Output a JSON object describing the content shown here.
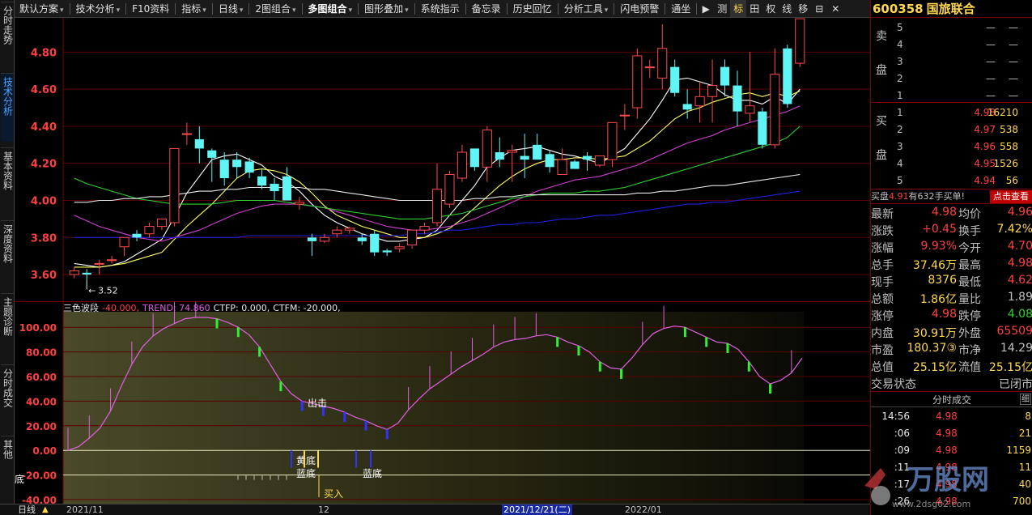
{
  "toolbar": {
    "items": [
      {
        "label": "默认方案",
        "dropdown": true
      },
      {
        "label": "技术分析",
        "dropdown": true
      },
      {
        "label": "F10资料",
        "dropdown": false
      },
      {
        "label": "指标",
        "dropdown": true
      },
      {
        "label": "日线",
        "dropdown": true
      },
      {
        "label": "2图组合",
        "dropdown": true
      },
      {
        "label": "多图组合",
        "dropdown": true,
        "active": true
      },
      {
        "label": "图形叠加",
        "dropdown": true
      },
      {
        "label": "系统指示",
        "dropdown": false
      },
      {
        "label": "备忘录",
        "dropdown": false
      },
      {
        "label": "历史回忆",
        "dropdown": false
      },
      {
        "label": "分析工具",
        "dropdown": true
      },
      {
        "label": "闪电预警",
        "dropdown": false
      },
      {
        "label": "通坐",
        "dropdown": false
      }
    ],
    "right_buttons": [
      "▶",
      "测",
      "标",
      "田",
      "权",
      "线",
      "移",
      "⊟",
      "✕"
    ],
    "right_highlight": "标"
  },
  "left_tabs": [
    {
      "label": "分时走势",
      "active": false
    },
    {
      "label": "技术分析",
      "active": true
    },
    {
      "label": "基本资料",
      "active": false
    },
    {
      "label": "深度资料",
      "active": false
    },
    {
      "label": "主题诊断",
      "active": false
    },
    {
      "label": "分时成交",
      "active": false
    },
    {
      "label": "其他",
      "active": false
    }
  ],
  "stock": {
    "code": "600358",
    "name": "国旅联合"
  },
  "sell_side_label": [
    "卖",
    "盘"
  ],
  "buy_side_label": [
    "买",
    "盘"
  ],
  "sell_orders": [
    {
      "level": "5",
      "price": "—",
      "vol": "—"
    },
    {
      "level": "4",
      "price": "—",
      "vol": "—"
    },
    {
      "level": "3",
      "price": "—",
      "vol": "—"
    },
    {
      "level": "2",
      "price": "—",
      "vol": "—"
    },
    {
      "level": "1",
      "price": "—",
      "vol": "—"
    }
  ],
  "buy_orders": [
    {
      "level": "1",
      "price": "4.98",
      "vol": "16210"
    },
    {
      "level": "2",
      "price": "4.97",
      "vol": "538"
    },
    {
      "level": "3",
      "price": "4.96",
      "vol": "558"
    },
    {
      "level": "4",
      "price": "4.95",
      "vol": "1526"
    },
    {
      "level": "5",
      "price": "4.94",
      "vol": "56"
    }
  ],
  "buy_line": {
    "prefix": "买盘",
    "price": "4.91",
    "text": "有632手买单!",
    "button": "点击查看"
  },
  "quote": [
    {
      "l1": "最新",
      "v1": "4.98",
      "c1": "red",
      "l2": "均价",
      "v2": "4.96",
      "c2": "red"
    },
    {
      "l1": "涨跌",
      "v1": "+0.45",
      "c1": "red",
      "l2": "换手",
      "v2": "7.42%",
      "c2": "yel"
    },
    {
      "l1": "涨幅",
      "v1": "9.93%",
      "c1": "red",
      "l2": "今开",
      "v2": "4.70",
      "c2": "red"
    },
    {
      "l1": "总手",
      "v1": "37.46万",
      "c1": "yel",
      "l2": "最高",
      "v2": "4.98",
      "c2": "red"
    },
    {
      "l1": "现手",
      "v1": "8376",
      "c1": "yel",
      "l2": "最低",
      "v2": "4.62",
      "c2": "red"
    },
    {
      "l1": "总额",
      "v1": "1.86亿",
      "c1": "yel",
      "l2": "量比",
      "v2": "1.89",
      "c2": "gry"
    },
    {
      "l1": "涨停",
      "v1": "4.98",
      "c1": "red",
      "l2": "跌停",
      "v2": "4.08",
      "c2": "grn"
    },
    {
      "l1": "内盘",
      "v1": "30.91万",
      "c1": "yel",
      "l2": "外盘",
      "v2": "65509",
      "c2": "red"
    },
    {
      "l1": "市盈",
      "v1": "180.37③",
      "c1": "yel",
      "l2": "市净",
      "v2": "14.29",
      "c2": "gry"
    },
    {
      "l1": "总值",
      "v1": "25.15亿",
      "c1": "yel",
      "l2": "流值",
      "v2": "25.15亿",
      "c2": "yel"
    },
    {
      "l1": "交易状态",
      "v1": "",
      "c1": "gry",
      "l2": "",
      "v2": "已闭市",
      "c2": "gry"
    }
  ],
  "ticks_header": {
    "title": "分时成交",
    "btn": "细"
  },
  "ticks": [
    {
      "time": "14:56",
      "price": "4.98",
      "vol": "8"
    },
    {
      "time": ":06",
      "price": "4.98",
      "vol": "21"
    },
    {
      "time": ":09",
      "price": "4.98",
      "vol": "1159"
    },
    {
      "time": ":11",
      "price": "4.98",
      "vol": "11"
    },
    {
      "time": ":17",
      "price": "4.98",
      "vol": "40"
    },
    {
      "time": ":26",
      "price": "4.98",
      "vol": "700"
    }
  ],
  "main_axis_labels": [
    "4.80",
    "4.60",
    "4.40",
    "4.20",
    "4.00",
    "3.80",
    "3.60"
  ],
  "low_marker": "3.52",
  "indicator": {
    "name": "三色波段",
    "v1": "-40.000,",
    "trend": "TREND: 74.860",
    "ctfp": "CTFP: 0.000,",
    "ctfm": "CTFM: -20.000,"
  },
  "sub_axis_labels": [
    "100.00",
    "80.00",
    "60.00",
    "40.00",
    "20.00",
    "0.00",
    "-20.00",
    "-40.00"
  ],
  "signals": {
    "sell": "出击",
    "yellow_bottom": "黄底",
    "blue_bottom1": "蓝底",
    "blue_bottom2": "蓝底",
    "buy": "买入",
    "bottom_left": "底"
  },
  "bottom": {
    "period": "日线",
    "d1": "2021/11",
    "d2": "12",
    "d3": "2021/12/21(二)",
    "d4": "2022/01"
  },
  "watermark": {
    "text": "万股网",
    "url": "www.2dsg02.com"
  },
  "chart_data": {
    "type": "candlestick",
    "ylim": [
      3.5,
      4.95
    ],
    "candles": [
      [
        3.6,
        3.62,
        3.58,
        3.64
      ],
      [
        3.61,
        3.6,
        3.57,
        3.63
      ],
      [
        3.66,
        3.66,
        3.6,
        3.68
      ],
      [
        3.68,
        3.68,
        3.66,
        3.7
      ],
      [
        3.75,
        3.8,
        3.7,
        3.8
      ],
      [
        3.82,
        3.8,
        3.78,
        3.84
      ],
      [
        3.82,
        3.86,
        3.8,
        3.88
      ],
      [
        3.86,
        3.9,
        3.84,
        3.9
      ],
      [
        3.88,
        4.28,
        3.86,
        4.28
      ],
      [
        4.36,
        4.36,
        4.3,
        4.42
      ],
      [
        4.33,
        4.28,
        4.2,
        4.4
      ],
      [
        4.27,
        4.23,
        4.1,
        4.28
      ],
      [
        4.22,
        4.12,
        4.08,
        4.26
      ],
      [
        4.22,
        4.18,
        4.12,
        4.26
      ],
      [
        4.21,
        4.15,
        4.12,
        4.23
      ],
      [
        4.13,
        4.08,
        4.06,
        4.17
      ],
      [
        4.09,
        4.05,
        4.0,
        4.12
      ],
      [
        4.13,
        4.0,
        4.0,
        4.18
      ],
      [
        3.98,
        3.99,
        3.95,
        4.02
      ],
      [
        3.8,
        3.78,
        3.7,
        3.82
      ],
      [
        3.78,
        3.8,
        3.77,
        3.82
      ],
      [
        3.82,
        3.84,
        3.8,
        3.86
      ],
      [
        3.84,
        3.85,
        3.82,
        3.86
      ],
      [
        3.8,
        3.78,
        3.76,
        3.82
      ],
      [
        3.82,
        3.72,
        3.7,
        3.84
      ],
      [
        3.73,
        3.72,
        3.7,
        3.74
      ],
      [
        3.74,
        3.75,
        3.72,
        3.77
      ],
      [
        3.76,
        3.84,
        3.74,
        3.84
      ],
      [
        3.84,
        3.86,
        3.82,
        3.88
      ],
      [
        3.88,
        4.06,
        3.86,
        4.2
      ],
      [
        3.98,
        4.14,
        3.96,
        4.16
      ],
      [
        4.12,
        4.26,
        4.1,
        4.3
      ],
      [
        4.28,
        4.18,
        4.16,
        4.28
      ],
      [
        4.18,
        4.38,
        4.1,
        4.4
      ],
      [
        4.26,
        4.22,
        4.18,
        4.34
      ],
      [
        4.26,
        4.27,
        4.1,
        4.3
      ],
      [
        4.24,
        4.22,
        4.12,
        4.36
      ],
      [
        4.3,
        4.22,
        4.22,
        4.36
      ],
      [
        4.25,
        4.18,
        4.15,
        4.27
      ],
      [
        4.14,
        4.22,
        4.14,
        4.28
      ],
      [
        4.21,
        4.17,
        4.17,
        4.22
      ],
      [
        4.24,
        4.22,
        4.16,
        4.26
      ],
      [
        4.19,
        4.24,
        4.18,
        4.24
      ],
      [
        4.22,
        4.42,
        4.18,
        4.42
      ],
      [
        4.46,
        4.46,
        4.38,
        4.52
      ],
      [
        4.5,
        4.78,
        4.44,
        4.82
      ],
      [
        4.72,
        4.72,
        4.66,
        4.76
      ],
      [
        4.66,
        4.82,
        4.6,
        4.95
      ],
      [
        4.72,
        4.58,
        4.56,
        4.76
      ],
      [
        4.52,
        4.49,
        4.44,
        4.6
      ],
      [
        4.51,
        4.56,
        4.42,
        4.64
      ],
      [
        4.56,
        4.62,
        4.42,
        4.76
      ],
      [
        4.72,
        4.62,
        4.56,
        4.76
      ],
      [
        4.62,
        4.48,
        4.4,
        4.7
      ],
      [
        4.47,
        4.51,
        4.42,
        4.8
      ],
      [
        4.48,
        4.3,
        4.28,
        4.5
      ],
      [
        4.3,
        4.68,
        4.28,
        4.82
      ],
      [
        4.82,
        4.52,
        4.5,
        4.84
      ],
      [
        4.74,
        4.98,
        4.72,
        4.98
      ]
    ],
    "ma": [
      {
        "name": "MA5",
        "color": "#ffffff",
        "values": [
          3.66,
          3.65,
          3.64,
          3.65,
          3.67,
          3.71,
          3.75,
          3.79,
          3.91,
          4.04,
          4.13,
          4.22,
          4.24,
          4.25,
          4.22,
          4.19,
          4.13,
          4.1,
          4.05,
          3.98,
          3.92,
          3.88,
          3.85,
          3.82,
          3.8,
          3.78,
          3.78,
          3.79,
          3.8,
          3.84,
          3.92,
          4.0,
          4.08,
          4.18,
          4.23,
          4.27,
          4.28,
          4.29,
          4.27,
          4.25,
          4.24,
          4.22,
          4.2,
          4.24,
          4.28,
          4.36,
          4.44,
          4.54,
          4.65,
          4.66,
          4.64,
          4.62,
          4.57,
          4.54,
          4.54,
          4.52,
          4.56,
          4.52,
          4.6
        ]
      },
      {
        "name": "MA10",
        "color": "#ffff66",
        "values": [
          3.64,
          3.64,
          3.64,
          3.65,
          3.66,
          3.68,
          3.7,
          3.72,
          3.79,
          3.86,
          3.92,
          3.98,
          4.05,
          4.12,
          4.16,
          4.17,
          4.16,
          4.14,
          4.1,
          4.04,
          3.97,
          3.92,
          3.89,
          3.86,
          3.84,
          3.82,
          3.8,
          3.8,
          3.8,
          3.82,
          3.85,
          3.9,
          3.96,
          4.02,
          4.08,
          4.13,
          4.17,
          4.2,
          4.22,
          4.22,
          4.23,
          4.23,
          4.22,
          4.23,
          4.24,
          4.28,
          4.32,
          4.38,
          4.44,
          4.48,
          4.5,
          4.53,
          4.55,
          4.57,
          4.58,
          4.56,
          4.58,
          4.56,
          4.59
        ]
      },
      {
        "name": "MA20",
        "color": "#d040d0",
        "values": [
          3.92,
          3.89,
          3.86,
          3.84,
          3.82,
          3.8,
          3.79,
          3.78,
          3.8,
          3.82,
          3.84,
          3.87,
          3.9,
          3.93,
          3.95,
          3.97,
          3.98,
          3.98,
          3.98,
          3.97,
          3.96,
          3.94,
          3.92,
          3.9,
          3.88,
          3.86,
          3.85,
          3.84,
          3.84,
          3.85,
          3.86,
          3.88,
          3.9,
          3.93,
          3.96,
          3.99,
          4.02,
          4.05,
          4.07,
          4.09,
          4.11,
          4.12,
          4.13,
          4.15,
          4.17,
          4.19,
          4.22,
          4.25,
          4.28,
          4.31,
          4.33,
          4.35,
          4.38,
          4.4,
          4.42,
          4.44,
          4.46,
          4.48,
          4.51
        ]
      },
      {
        "name": "MA30",
        "color": "#30d030",
        "values": [
          4.12,
          4.09,
          4.07,
          4.05,
          4.03,
          4.01,
          4.0,
          3.99,
          3.98,
          3.98,
          3.98,
          3.98,
          3.99,
          4.0,
          4.0,
          4.0,
          4.0,
          3.99,
          3.98,
          3.97,
          3.96,
          3.95,
          3.94,
          3.93,
          3.92,
          3.91,
          3.9,
          3.9,
          3.9,
          3.91,
          3.92,
          3.93,
          3.95,
          3.97,
          3.99,
          4.01,
          4.02,
          4.03,
          4.04,
          4.04,
          4.04,
          4.05,
          4.05,
          4.06,
          4.07,
          4.09,
          4.11,
          4.13,
          4.15,
          4.17,
          4.19,
          4.21,
          4.23,
          4.25,
          4.27,
          4.29,
          4.31,
          4.34,
          4.4
        ]
      },
      {
        "name": "MA60",
        "color": "#e8e8e8",
        "values": [
          3.99,
          3.99,
          4.0,
          4.0,
          4.01,
          4.01,
          4.02,
          4.02,
          4.03,
          4.04,
          4.05,
          4.05,
          4.06,
          4.06,
          4.07,
          4.07,
          4.07,
          4.07,
          4.07,
          4.06,
          4.06,
          4.05,
          4.04,
          4.03,
          4.02,
          4.01,
          4.0,
          4.0,
          4.0,
          4.0,
          4.0,
          4.0,
          4.01,
          4.01,
          4.02,
          4.02,
          4.03,
          4.03,
          4.03,
          4.03,
          4.03,
          4.03,
          4.03,
          4.03,
          4.03,
          4.04,
          4.04,
          4.05,
          4.05,
          4.06,
          4.07,
          4.08,
          4.08,
          4.09,
          4.1,
          4.11,
          4.12,
          4.13,
          4.14
        ]
      },
      {
        "name": "MA120",
        "color": "#2020e0",
        "values": [
          3.8,
          3.8,
          3.8,
          3.8,
          3.8,
          3.8,
          3.8,
          3.8,
          3.8,
          3.8,
          3.8,
          3.8,
          3.8,
          3.8,
          3.81,
          3.81,
          3.81,
          3.81,
          3.81,
          3.81,
          3.81,
          3.81,
          3.81,
          3.81,
          3.81,
          3.81,
          3.81,
          3.82,
          3.82,
          3.83,
          3.84,
          3.84,
          3.85,
          3.86,
          3.87,
          3.87,
          3.88,
          3.88,
          3.89,
          3.9,
          3.9,
          3.91,
          3.92,
          3.92,
          3.93,
          3.94,
          3.95,
          3.96,
          3.97,
          3.98,
          3.98,
          3.99,
          3.99,
          4.0,
          4.01,
          4.02,
          4.03,
          4.04,
          4.05
        ]
      }
    ],
    "sub_series": {
      "name": "TREND",
      "ylim": [
        -40,
        110
      ],
      "values": [
        0,
        3,
        10,
        18,
        32,
        52,
        70,
        84,
        93,
        99,
        103,
        107,
        108,
        108,
        107,
        104,
        100,
        94,
        84,
        70,
        56,
        46,
        40,
        38,
        36,
        34,
        31,
        27,
        24,
        20,
        17,
        22,
        33,
        42,
        50,
        56,
        62,
        68,
        73,
        78,
        84,
        88,
        90,
        91,
        93,
        94,
        92,
        88,
        85,
        80,
        72,
        67,
        66,
        75,
        86,
        95,
        99,
        101,
        100,
        96,
        92,
        88,
        87,
        82,
        72,
        60,
        54,
        57,
        63,
        75
      ]
    }
  }
}
